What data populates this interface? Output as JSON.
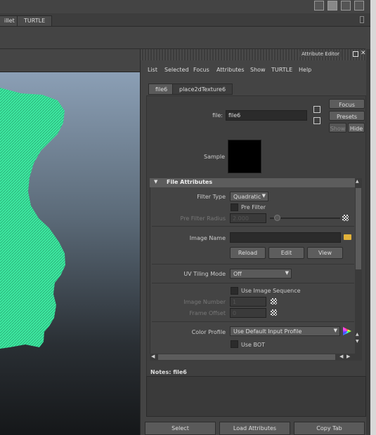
{
  "shelf": {
    "tabs": [
      "illet",
      "TURTLE"
    ]
  },
  "attribute_editor": {
    "title": "Attribute Editor",
    "menu": [
      "List",
      "Selected",
      "Focus",
      "Attributes",
      "Show",
      "TURTLE",
      "Help"
    ],
    "node_tabs": [
      "file6",
      "place2dTexture6"
    ],
    "file_label": "file:",
    "file_value": "file6",
    "buttons": {
      "focus": "Focus",
      "presets": "Presets",
      "show": "Show",
      "hide": "Hide"
    },
    "sample_label": "Sample",
    "section_title": "File Attributes",
    "filter_type_label": "Filter Type",
    "filter_type_value": "Quadratic",
    "pre_filter_label": "Pre Filter",
    "pre_filter_radius_label": "Pre Filter Radius",
    "pre_filter_radius_value": "2.000",
    "image_name_label": "Image Name",
    "image_name_value": "",
    "reload_label": "Reload",
    "edit_label": "Edit",
    "view_label": "View",
    "uv_tiling_label": "UV Tiling Mode",
    "uv_tiling_value": "Off",
    "use_image_sequence_label": "Use Image Sequence",
    "image_number_label": "Image Number",
    "image_number_value": "1",
    "frame_offset_label": "Frame Offset",
    "frame_offset_value": "0",
    "color_profile_label": "Color Profile",
    "color_profile_value": "Use Default Input Profile",
    "use_bot_label": "Use BOT",
    "notes_label": "Notes:  file6",
    "bottom_buttons": [
      "Select",
      "Load Attributes",
      "Copy Tab"
    ]
  },
  "colors": {
    "mesh": "#3de8a0",
    "panel": "#444444",
    "sample_swatch": "#000000"
  }
}
